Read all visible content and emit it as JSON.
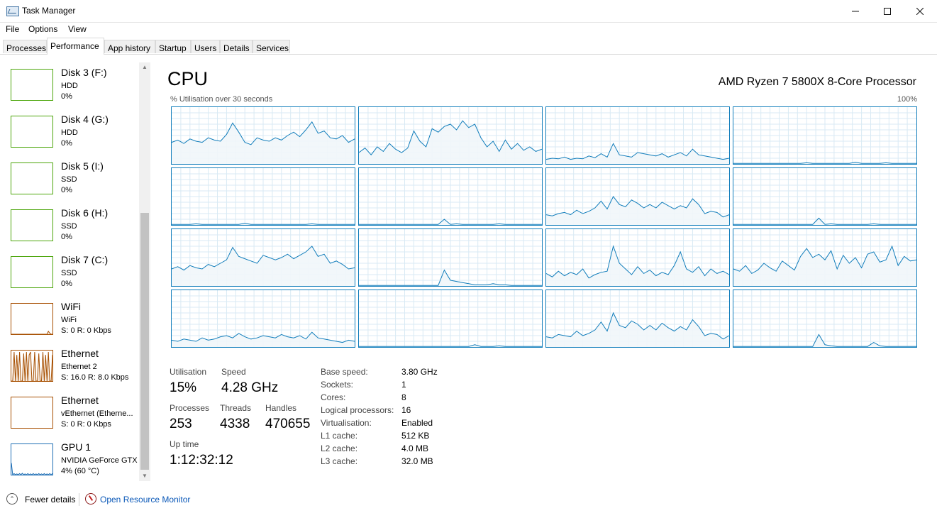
{
  "window": {
    "title": "Task Manager",
    "minimize_icon": "minimize-icon",
    "maximize_icon": "maximize-icon",
    "close_icon": "close-icon"
  },
  "menu": [
    "File",
    "Options",
    "View"
  ],
  "tabs": [
    {
      "label": "Processes",
      "active": false
    },
    {
      "label": "Performance",
      "active": true
    },
    {
      "label": "App history",
      "active": false
    },
    {
      "label": "Startup",
      "active": false
    },
    {
      "label": "Users",
      "active": false
    },
    {
      "label": "Details",
      "active": false
    },
    {
      "label": "Services",
      "active": false
    }
  ],
  "sidebar": {
    "items": [
      {
        "title": "Disk 3 (F:)",
        "sub": "HDD",
        "value": "0%",
        "kind": "disk",
        "color": "#4da60c"
      },
      {
        "title": "Disk 4 (G:)",
        "sub": "HDD",
        "value": "0%",
        "kind": "disk",
        "color": "#4da60c"
      },
      {
        "title": "Disk 5 (I:)",
        "sub": "SSD",
        "value": "0%",
        "kind": "disk",
        "color": "#4da60c"
      },
      {
        "title": "Disk 6 (H:)",
        "sub": "SSD",
        "value": "0%",
        "kind": "disk",
        "color": "#4da60c"
      },
      {
        "title": "Disk 7 (C:)",
        "sub": "SSD",
        "value": "0%",
        "kind": "disk",
        "color": "#4da60c"
      },
      {
        "title": "WiFi",
        "sub": "WiFi",
        "value": "S: 0 R: 0 Kbps",
        "kind": "wifi",
        "color": "#a74f01"
      },
      {
        "title": "Ethernet",
        "sub": "Ethernet 2",
        "value": "S: 16.0 R: 8.0 Kbps",
        "kind": "ethernet-active",
        "color": "#a74f01"
      },
      {
        "title": "Ethernet",
        "sub": "vEthernet (Etherne...",
        "value": "S: 0 R: 0 Kbps",
        "kind": "ethernet",
        "color": "#a74f01"
      },
      {
        "title": "GPU 1",
        "sub": "NVIDIA GeForce GTX",
        "value": "4% (60 °C)",
        "kind": "gpu",
        "color": "#1f6fb5"
      }
    ]
  },
  "cpu": {
    "title": "CPU",
    "model": "AMD Ryzen 7 5800X 8-Core Processor",
    "graph_label": "% Utilisation over 30 seconds",
    "graph_max": "100%",
    "line_color": "#117dbb",
    "fill_color": "#f1f6fa",
    "grid_color": "#d9eaf4",
    "stats": {
      "utilisation_label": "Utilisation",
      "utilisation": "15%",
      "speed_label": "Speed",
      "speed": "4.28 GHz",
      "processes_label": "Processes",
      "processes": "253",
      "threads_label": "Threads",
      "threads": "4338",
      "handles_label": "Handles",
      "handles": "470655",
      "uptime_label": "Up time",
      "uptime": "1:12:32:12"
    },
    "specs": [
      {
        "label": "Base speed:",
        "value": "3.80 GHz"
      },
      {
        "label": "Sockets:",
        "value": "1"
      },
      {
        "label": "Cores:",
        "value": "8"
      },
      {
        "label": "Logical processors:",
        "value": "16"
      },
      {
        "label": "Virtualisation:",
        "value": "Enabled"
      },
      {
        "label": "L1 cache:",
        "value": "512 KB"
      },
      {
        "label": "L2 cache:",
        "value": "4.0 MB"
      },
      {
        "label": "L3 cache:",
        "value": "32.0 MB"
      }
    ]
  },
  "chart_data": {
    "type": "line",
    "title": "% Utilisation over 30 seconds",
    "ylim": [
      0,
      100
    ],
    "x": [
      0,
      1,
      2,
      3,
      4,
      5,
      6,
      7,
      8,
      9,
      10,
      11,
      12,
      13,
      14,
      15,
      16,
      17,
      18,
      19,
      20,
      21,
      22,
      23,
      24,
      25,
      26,
      27,
      28,
      29,
      30
    ],
    "series": [
      {
        "values": [
          38,
          42,
          36,
          44,
          40,
          38,
          46,
          42,
          40,
          52,
          72,
          56,
          38,
          34,
          46,
          42,
          40,
          46,
          42,
          50,
          56,
          48,
          60,
          74,
          54,
          58,
          46,
          44,
          50,
          38,
          44
        ]
      },
      {
        "values": [
          20,
          28,
          16,
          30,
          22,
          36,
          26,
          20,
          28,
          58,
          40,
          30,
          62,
          56,
          66,
          70,
          60,
          76,
          64,
          70,
          46,
          30,
          40,
          22,
          42,
          26,
          36,
          24,
          30,
          22,
          26
        ]
      },
      {
        "values": [
          8,
          10,
          9,
          12,
          8,
          10,
          9,
          14,
          11,
          18,
          12,
          36,
          16,
          14,
          12,
          20,
          18,
          16,
          14,
          18,
          12,
          16,
          20,
          14,
          26,
          16,
          14,
          12,
          10,
          8,
          10
        ]
      },
      {
        "values": [
          1,
          1,
          1,
          1,
          1,
          1,
          1,
          1,
          1,
          1,
          1,
          1,
          2,
          1,
          1,
          1,
          1,
          1,
          1,
          1,
          3,
          1,
          1,
          1,
          1,
          2,
          1,
          1,
          1,
          1,
          1
        ]
      },
      {
        "values": [
          1,
          1,
          1,
          1,
          2,
          1,
          1,
          1,
          1,
          1,
          1,
          1,
          3,
          1,
          1,
          1,
          1,
          1,
          1,
          1,
          1,
          1,
          1,
          2,
          1,
          1,
          1,
          1,
          1,
          1,
          1
        ]
      },
      {
        "values": [
          1,
          1,
          1,
          1,
          1,
          1,
          1,
          1,
          1,
          1,
          1,
          1,
          1,
          1,
          10,
          1,
          2,
          1,
          1,
          1,
          1,
          1,
          1,
          2,
          1,
          1,
          1,
          1,
          1,
          1,
          1
        ]
      },
      {
        "values": [
          18,
          16,
          20,
          22,
          18,
          26,
          20,
          24,
          30,
          42,
          28,
          50,
          36,
          32,
          44,
          38,
          30,
          36,
          30,
          40,
          34,
          28,
          34,
          30,
          46,
          36,
          20,
          24,
          22,
          14,
          18
        ]
      },
      {
        "values": [
          1,
          1,
          1,
          1,
          1,
          1,
          1,
          1,
          1,
          1,
          1,
          1,
          1,
          1,
          12,
          1,
          2,
          1,
          1,
          1,
          1,
          1,
          1,
          2,
          1,
          1,
          1,
          1,
          1,
          1,
          1
        ]
      },
      {
        "values": [
          30,
          34,
          28,
          36,
          32,
          30,
          38,
          34,
          40,
          46,
          68,
          52,
          48,
          44,
          40,
          54,
          50,
          46,
          50,
          56,
          48,
          54,
          60,
          70,
          52,
          56,
          40,
          44,
          38,
          30,
          32
        ]
      },
      {
        "values": [
          1,
          1,
          1,
          1,
          1,
          1,
          1,
          1,
          1,
          1,
          1,
          1,
          1,
          1,
          28,
          10,
          8,
          6,
          4,
          2,
          2,
          2,
          4,
          2,
          2,
          1,
          1,
          1,
          1,
          1,
          1
        ]
      },
      {
        "values": [
          22,
          16,
          26,
          18,
          24,
          20,
          30,
          14,
          20,
          24,
          26,
          70,
          40,
          30,
          20,
          34,
          22,
          28,
          18,
          24,
          20,
          36,
          60,
          30,
          24,
          34,
          18,
          30,
          22,
          26,
          20
        ]
      },
      {
        "values": [
          30,
          26,
          36,
          22,
          28,
          40,
          32,
          26,
          44,
          36,
          28,
          52,
          66,
          50,
          56,
          46,
          62,
          30,
          54,
          40,
          50,
          32,
          56,
          60,
          42,
          46,
          70,
          36,
          52,
          44,
          46
        ]
      },
      {
        "values": [
          12,
          10,
          14,
          12,
          10,
          16,
          12,
          14,
          18,
          20,
          16,
          24,
          18,
          14,
          16,
          20,
          18,
          16,
          22,
          18,
          16,
          20,
          14,
          26,
          16,
          14,
          12,
          10,
          8,
          12,
          10
        ]
      },
      {
        "values": [
          1,
          1,
          1,
          1,
          1,
          1,
          1,
          1,
          1,
          1,
          1,
          1,
          1,
          1,
          1,
          1,
          1,
          1,
          1,
          4,
          1,
          1,
          1,
          2,
          1,
          1,
          1,
          1,
          1,
          1,
          1
        ]
      },
      {
        "values": [
          18,
          16,
          22,
          20,
          18,
          28,
          20,
          24,
          30,
          44,
          28,
          60,
          38,
          34,
          46,
          40,
          30,
          38,
          30,
          42,
          34,
          28,
          36,
          30,
          48,
          36,
          20,
          24,
          22,
          14,
          20
        ]
      },
      {
        "values": [
          1,
          1,
          1,
          1,
          1,
          1,
          1,
          1,
          1,
          1,
          1,
          1,
          1,
          1,
          22,
          4,
          2,
          1,
          1,
          1,
          1,
          1,
          1,
          8,
          2,
          1,
          1,
          1,
          1,
          1,
          1
        ]
      }
    ]
  },
  "sidebar_graphs": {
    "wifi": [
      0,
      0,
      0,
      0,
      0,
      0,
      0,
      0,
      0,
      0,
      0,
      0,
      0,
      0,
      0,
      0,
      0,
      0,
      0,
      0,
      0,
      0,
      0,
      0,
      0,
      0,
      0,
      10,
      4,
      0,
      0
    ],
    "ethernet-active": [
      0,
      0,
      100,
      0,
      90,
      0,
      100,
      0,
      0,
      95,
      0,
      100,
      0,
      90,
      100,
      0,
      0,
      100,
      0,
      0,
      95,
      0,
      0,
      100,
      0,
      90,
      0,
      100,
      0,
      0,
      90
    ],
    "gpu": [
      40,
      0,
      4,
      0,
      3,
      0,
      4,
      0,
      5,
      0,
      3,
      0,
      4,
      0,
      3,
      0,
      4,
      0,
      3,
      0,
      4,
      0,
      3,
      0,
      4,
      0,
      3,
      0,
      4,
      0,
      4
    ]
  },
  "footer": {
    "fewer_details": "Fewer details",
    "open_resource_monitor": "Open Resource Monitor"
  }
}
